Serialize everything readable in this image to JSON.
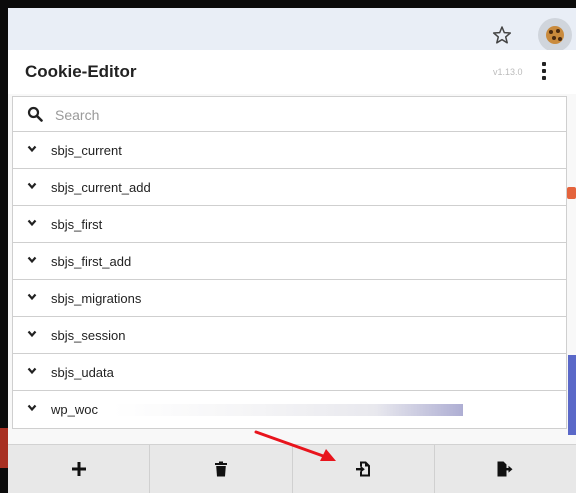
{
  "app": {
    "title": "Cookie-Editor",
    "version": "v1.13.0"
  },
  "search": {
    "placeholder": "Search",
    "value": ""
  },
  "cookies": [
    {
      "name": "sbjs_current"
    },
    {
      "name": "sbjs_current_add"
    },
    {
      "name": "sbjs_first"
    },
    {
      "name": "sbjs_first_add"
    },
    {
      "name": "sbjs_migrations"
    },
    {
      "name": "sbjs_session"
    },
    {
      "name": "sbjs_udata"
    },
    {
      "name": "wp_woc"
    }
  ],
  "footer": {
    "buttons": [
      "add-icon",
      "delete-all-icon",
      "import-icon",
      "export-icon"
    ]
  },
  "browser_toolbar": {
    "icons": [
      "bookmark-star-icon",
      "cookie-extension-icon"
    ]
  },
  "annotation": {
    "arrow_color": "#e8141c"
  }
}
